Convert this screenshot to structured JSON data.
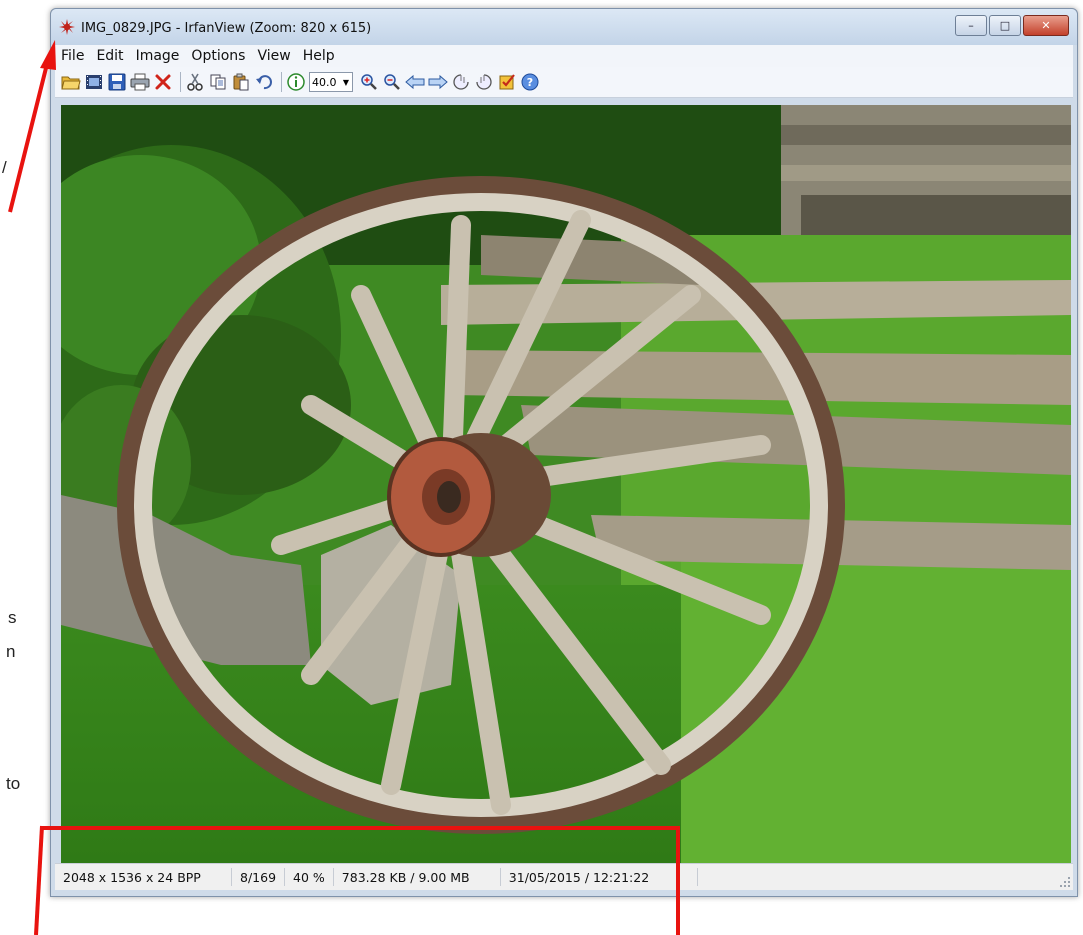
{
  "page": {
    "side_text_top": "/",
    "side_text_1": "s",
    "side_text_2": "n",
    "side_text_3": "to"
  },
  "window": {
    "title": "IMG_0829.JPG - IrfanView (Zoom: 820 x 615)",
    "controls": {
      "minimize": "–",
      "maximize": "□",
      "close": "✕"
    }
  },
  "menu": [
    {
      "label": "File"
    },
    {
      "label": "Edit"
    },
    {
      "label": "Image"
    },
    {
      "label": "Options"
    },
    {
      "label": "View"
    },
    {
      "label": "Help"
    }
  ],
  "toolbar": {
    "zoom_value": "40.0",
    "icons": [
      "open-folder-icon",
      "slideshow-icon",
      "save-icon",
      "print-icon",
      "delete-icon",
      "cut-icon",
      "copy-icon",
      "paste-icon",
      "undo-icon",
      "info-icon",
      "zoom-in-icon",
      "zoom-out-icon",
      "previous-icon",
      "next-icon",
      "rotate-left-icon",
      "rotate-right-icon",
      "properties-icon",
      "help-icon"
    ]
  },
  "status": {
    "dimensions": "2048 x 1536 x 24 BPP",
    "position": "8/169",
    "zoom": "40 %",
    "size": "783.28 KB / 9.00 MB",
    "datetime": "31/05/2015 / 12:21:22"
  },
  "colors": {
    "annotation": "#e8130f",
    "title_bg": "#d4e1f1",
    "close_button": "#c84a33"
  }
}
